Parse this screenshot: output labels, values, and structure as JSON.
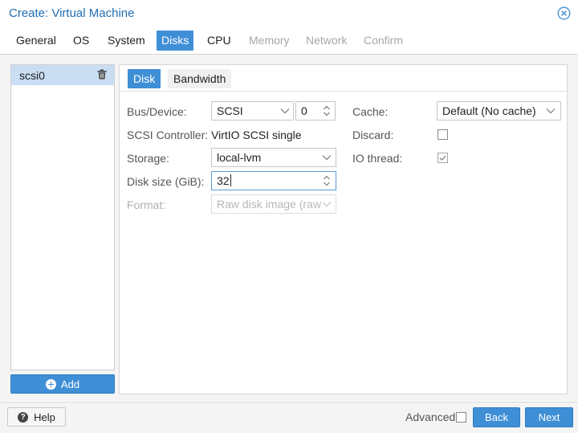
{
  "window": {
    "title": "Create: Virtual Machine"
  },
  "tabs": [
    {
      "label": "General",
      "state": "normal"
    },
    {
      "label": "OS",
      "state": "normal"
    },
    {
      "label": "System",
      "state": "normal"
    },
    {
      "label": "Disks",
      "state": "active"
    },
    {
      "label": "CPU",
      "state": "normal"
    },
    {
      "label": "Memory",
      "state": "disabled"
    },
    {
      "label": "Network",
      "state": "disabled"
    },
    {
      "label": "Confirm",
      "state": "disabled"
    }
  ],
  "disks": {
    "items": [
      {
        "label": "scsi0"
      }
    ],
    "add_label": "Add"
  },
  "subtabs": [
    {
      "label": "Disk"
    },
    {
      "label": "Bandwidth"
    }
  ],
  "form": {
    "bus_device_label": "Bus/Device:",
    "bus_value": "SCSI",
    "device_value": "0",
    "scsi_controller_label": "SCSI Controller:",
    "scsi_controller_value": "VirtIO SCSI single",
    "storage_label": "Storage:",
    "storage_value": "local-lvm",
    "disk_size_label": "Disk size (GiB):",
    "disk_size_value": "32",
    "format_label": "Format:",
    "format_value": "Raw disk image (raw",
    "cache_label": "Cache:",
    "cache_value": "Default (No cache)",
    "discard_label": "Discard:",
    "discard_checked": false,
    "io_thread_label": "IO thread:",
    "io_thread_checked": true
  },
  "footer": {
    "help_label": "Help",
    "advanced_label": "Advanced",
    "advanced_checked": false,
    "back_label": "Back",
    "next_label": "Next"
  },
  "icons": {
    "close": "close-icon",
    "trash": "trash-icon",
    "add": "plus-circle-icon",
    "help": "question-circle-icon",
    "dropdown": "chevron-down-icon",
    "spinner": "spinner-arrows-icon"
  },
  "colors": {
    "accent": "#3f8fd6",
    "title": "#1f6eb3",
    "selected_row": "#c9def3"
  }
}
